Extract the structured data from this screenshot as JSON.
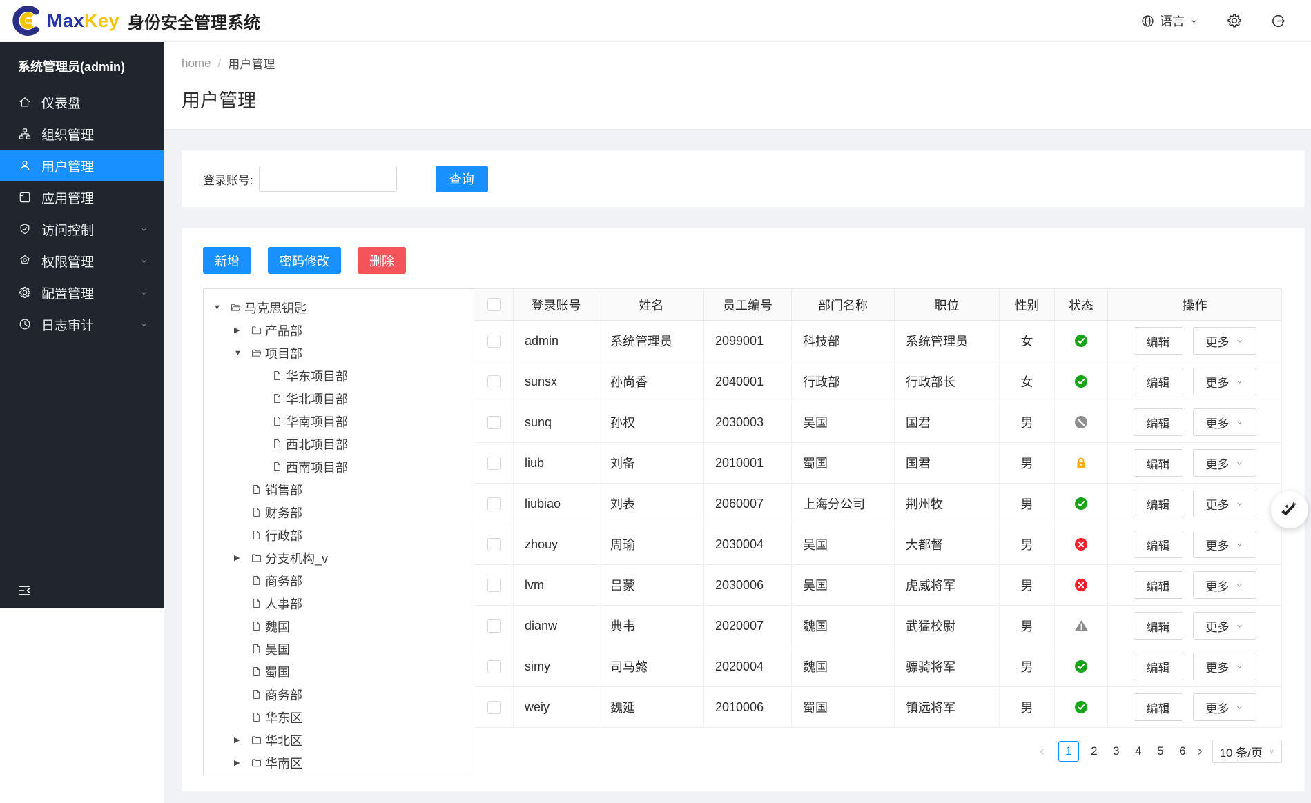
{
  "brand": {
    "name_primary": "Max",
    "name_secondary": "Key",
    "app_title": "身份安全管理系统"
  },
  "topbar": {
    "language_label": "语言"
  },
  "colors": {
    "primary": "#1890ff",
    "danger": "#f5545a",
    "sidebar_bg": "#20252e",
    "status_active": "#18a418",
    "status_inactive": "#f5222d",
    "status_locked": "#faad14",
    "status_disabled": "#8f8f8f",
    "status_warning": "#8c8c8c"
  },
  "sidebar": {
    "user_title": "系统管理员(admin)",
    "items": [
      {
        "key": "dashboard",
        "label": "仪表盘",
        "icon": "home-icon",
        "active": false,
        "has_children": false
      },
      {
        "key": "organizations",
        "label": "组织管理",
        "icon": "org-icon",
        "active": false,
        "has_children": false
      },
      {
        "key": "users",
        "label": "用户管理",
        "icon": "user-icon",
        "active": true,
        "has_children": false
      },
      {
        "key": "applications",
        "label": "应用管理",
        "icon": "app-icon",
        "active": false,
        "has_children": false
      },
      {
        "key": "access",
        "label": "访问控制",
        "icon": "shield-icon",
        "active": false,
        "has_children": true
      },
      {
        "key": "permissions",
        "label": "权限管理",
        "icon": "medal-icon",
        "active": false,
        "has_children": true
      },
      {
        "key": "configuration",
        "label": "配置管理",
        "icon": "gear-icon",
        "active": false,
        "has_children": true
      },
      {
        "key": "audit",
        "label": "日志审计",
        "icon": "clock-icon",
        "active": false,
        "has_children": true
      }
    ]
  },
  "breadcrumb": {
    "home": "home",
    "separator": "/",
    "current": "用户管理"
  },
  "page_title": "用户管理",
  "search": {
    "label": "登录账号:",
    "value": "",
    "placeholder": "",
    "submit_label": "查询"
  },
  "toolbar": [
    {
      "key": "add",
      "label": "新增",
      "type": "primary"
    },
    {
      "key": "change-password",
      "label": "密码修改",
      "type": "primary"
    },
    {
      "key": "delete",
      "label": "删除",
      "type": "danger"
    }
  ],
  "tree": [
    {
      "label": "马克思钥匙",
      "level": 0,
      "icon": "folder-open-icon",
      "caret": "down"
    },
    {
      "label": "产品部",
      "level": 1,
      "icon": "folder-icon",
      "caret": "right"
    },
    {
      "label": "项目部",
      "level": 1,
      "icon": "folder-open-icon",
      "caret": "down"
    },
    {
      "label": "华东项目部",
      "level": 2,
      "icon": "file-icon",
      "caret": "none"
    },
    {
      "label": "华北项目部",
      "level": 2,
      "icon": "file-icon",
      "caret": "none"
    },
    {
      "label": "华南项目部",
      "level": 2,
      "icon": "file-icon",
      "caret": "none"
    },
    {
      "label": "西北项目部",
      "level": 2,
      "icon": "file-icon",
      "caret": "none"
    },
    {
      "label": "西南项目部",
      "level": 2,
      "icon": "file-icon",
      "caret": "none"
    },
    {
      "label": "销售部",
      "level": 1,
      "icon": "file-icon",
      "caret": "none"
    },
    {
      "label": "财务部",
      "level": 1,
      "icon": "file-icon",
      "caret": "none"
    },
    {
      "label": "行政部",
      "level": 1,
      "icon": "file-icon",
      "caret": "none"
    },
    {
      "label": "分支机构_v",
      "level": 1,
      "icon": "folder-icon",
      "caret": "right"
    },
    {
      "label": "商务部",
      "level": 1,
      "icon": "file-icon",
      "caret": "none"
    },
    {
      "label": "人事部",
      "level": 1,
      "icon": "file-icon",
      "caret": "none"
    },
    {
      "label": "魏国",
      "level": 1,
      "icon": "file-icon",
      "caret": "none"
    },
    {
      "label": "吴国",
      "level": 1,
      "icon": "file-icon",
      "caret": "none"
    },
    {
      "label": "蜀国",
      "level": 1,
      "icon": "file-icon",
      "caret": "none"
    },
    {
      "label": "商务部",
      "level": 1,
      "icon": "file-icon",
      "caret": "none"
    },
    {
      "label": "华东区",
      "level": 1,
      "icon": "file-icon",
      "caret": "none"
    },
    {
      "label": "华北区",
      "level": 1,
      "icon": "folder-icon",
      "caret": "right"
    },
    {
      "label": "华南区",
      "level": 1,
      "icon": "folder-icon",
      "caret": "right"
    }
  ],
  "table": {
    "headers": [
      "登录账号",
      "姓名",
      "员工编号",
      "部门名称",
      "职位",
      "性别",
      "状态",
      "操作"
    ],
    "actions": {
      "edit": "编辑",
      "more": "更多"
    },
    "rows": [
      {
        "login_account": "admin",
        "name": "系统管理员",
        "employee_no": "2099001",
        "department": "科技部",
        "position": "系统管理员",
        "gender": "女",
        "status": "active"
      },
      {
        "login_account": "sunsx",
        "name": "孙尚香",
        "employee_no": "2040001",
        "department": "行政部",
        "position": "行政部长",
        "gender": "女",
        "status": "active"
      },
      {
        "login_account": "sunq",
        "name": "孙权",
        "employee_no": "2030003",
        "department": "吴国",
        "position": "国君",
        "gender": "男",
        "status": "disabled"
      },
      {
        "login_account": "liub",
        "name": "刘备",
        "employee_no": "2010001",
        "department": "蜀国",
        "position": "国君",
        "gender": "男",
        "status": "locked"
      },
      {
        "login_account": "liubiao",
        "name": "刘表",
        "employee_no": "2060007",
        "department": "上海分公司",
        "position": "荆州牧",
        "gender": "男",
        "status": "active"
      },
      {
        "login_account": "zhouy",
        "name": "周瑜",
        "employee_no": "2030004",
        "department": "吴国",
        "position": "大都督",
        "gender": "男",
        "status": "inactive"
      },
      {
        "login_account": "lvm",
        "name": "吕蒙",
        "employee_no": "2030006",
        "department": "吴国",
        "position": "虎威将军",
        "gender": "男",
        "status": "inactive"
      },
      {
        "login_account": "dianw",
        "name": "典韦",
        "employee_no": "2020007",
        "department": "魏国",
        "position": "武猛校尉",
        "gender": "男",
        "status": "warning"
      },
      {
        "login_account": "simy",
        "name": "司马懿",
        "employee_no": "2020004",
        "department": "魏国",
        "position": "骠骑将军",
        "gender": "男",
        "status": "active"
      },
      {
        "login_account": "weiy",
        "name": "魏延",
        "employee_no": "2010006",
        "department": "蜀国",
        "position": "镇远将军",
        "gender": "男",
        "status": "active"
      }
    ]
  },
  "pagination": {
    "prev": "‹",
    "next": "›",
    "pages": [
      "1",
      "2",
      "3",
      "4",
      "5",
      "6"
    ],
    "current": "1",
    "page_size_label": "10 条/页"
  }
}
